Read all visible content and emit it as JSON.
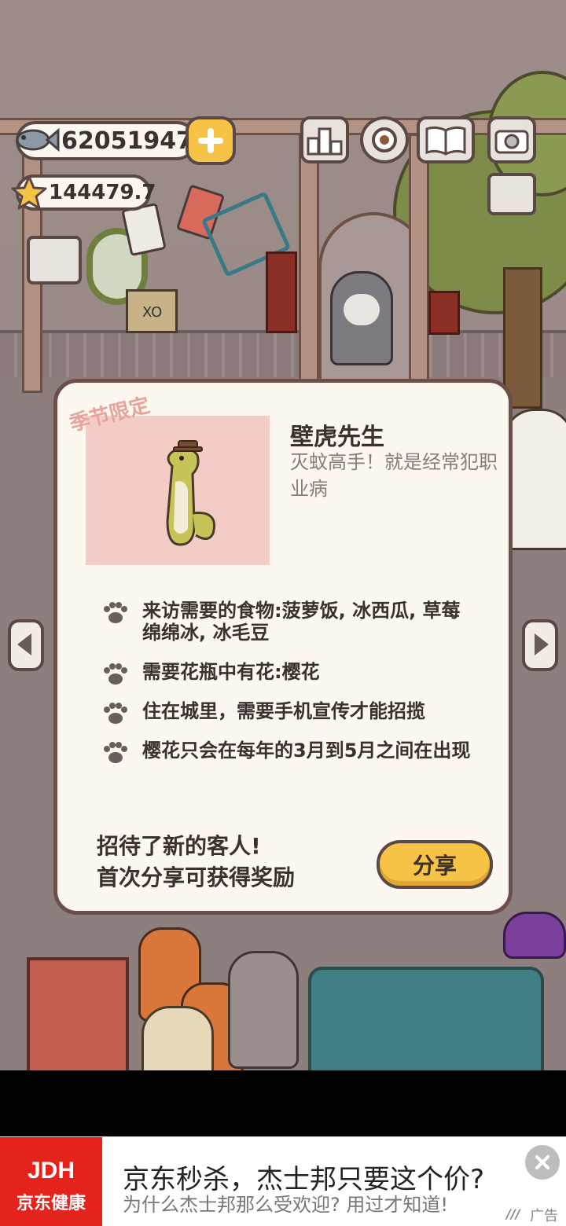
{
  "hud": {
    "fish_count": "62051947",
    "star_count": "144479.7"
  },
  "dialog": {
    "tag": "季节限定",
    "name": "壁虎先生",
    "description": "灭蚊高手！就是经常犯职业病",
    "requirements": [
      "来访需要的食物:菠萝饭, 冰西瓜, 草莓绵绵冰, 冰毛豆",
      "需要花瓶中有花:樱花",
      "住在城里，需要手机宣传才能招揽",
      "樱花只会在每年的3月到5月之间在出现"
    ],
    "footer_line1": "招待了新的客人!",
    "footer_line2": "首次分享可获得奖励",
    "share_label": "分享"
  },
  "scene": {
    "box_label": "XO"
  },
  "ad": {
    "brand_top": "JDH",
    "brand_bottom": "京东健康",
    "title": "京东秒杀，杰士邦只要这个价?",
    "subtitle": "为什么杰士邦那么受欢迎? 用过才知道!",
    "tag": "广告"
  },
  "colors": {
    "accent_yellow": "#f6c347",
    "outline_brown": "#5a4844",
    "dialog_bg": "#fcf7ef",
    "ad_red": "#e3231c"
  }
}
